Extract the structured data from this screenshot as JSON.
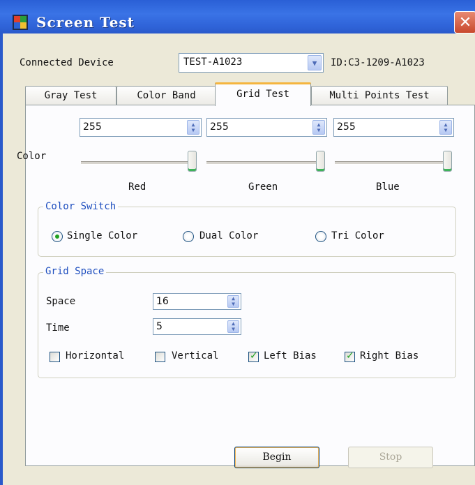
{
  "window": {
    "title": "Screen Test",
    "close_symbol": "✕",
    "app_icon": "screen-test-app-icon",
    "colors": {
      "titlebar": "#2a5fd6",
      "client": "#ece9d8",
      "tab_highlight": "#f5b53e"
    }
  },
  "device": {
    "label": "Connected Device",
    "selected": "TEST-A1023",
    "id_text": "ID:C3-1209-A1023"
  },
  "tabs": [
    {
      "label": "Gray Test",
      "active": false
    },
    {
      "label": "Color Band",
      "active": false
    },
    {
      "label": "Grid Test",
      "active": true
    },
    {
      "label": "Multi Points Test",
      "active": false
    }
  ],
  "color": {
    "label": "Color",
    "channels": [
      {
        "name": "Red",
        "value": "255",
        "level": 255,
        "max": 255
      },
      {
        "name": "Green",
        "value": "255",
        "level": 255,
        "max": 255
      },
      {
        "name": "Blue",
        "value": "255",
        "level": 255,
        "max": 255
      }
    ]
  },
  "color_switch": {
    "title": "Color Switch",
    "options": [
      {
        "label": "Single Color",
        "selected": true
      },
      {
        "label": "Dual Color",
        "selected": false
      },
      {
        "label": "Tri Color",
        "selected": false
      }
    ]
  },
  "grid_space": {
    "title": "Grid Space",
    "space_label": "Space",
    "space_value": "16",
    "time_label": "Time",
    "time_value": "5",
    "checks": [
      {
        "label": "Horizontal",
        "checked": false
      },
      {
        "label": "Vertical",
        "checked": false
      },
      {
        "label": "Left Bias",
        "checked": true
      },
      {
        "label": "Right Bias",
        "checked": true
      }
    ]
  },
  "actions": {
    "begin": "Begin",
    "stop": "Stop",
    "stop_enabled": false
  }
}
